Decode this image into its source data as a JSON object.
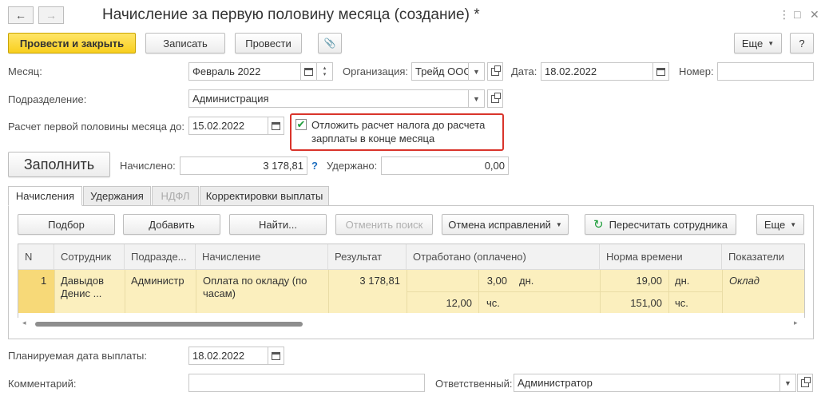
{
  "window": {
    "title": "Начисление за первую половину месяца (создание) *",
    "back_icon": "←",
    "forward_icon": "→",
    "menu_icon": "⋮",
    "maximize_icon": "□",
    "close_icon": "✕"
  },
  "toolbar": {
    "post_and_close": "Провести и закрыть",
    "save": "Записать",
    "post": "Провести",
    "attach_icon": "📎",
    "more": "Еще",
    "help": "?"
  },
  "form": {
    "month_label": "Месяц:",
    "month_value": "Февраль 2022",
    "org_label": "Организация:",
    "org_value": "Трейд ООС",
    "date_label": "Дата:",
    "date_value": "18.02.2022",
    "number_label": "Номер:",
    "number_value": "",
    "dept_label": "Подразделение:",
    "dept_value": "Администрация",
    "first_half_label": "Расчет первой половины месяца до:",
    "first_half_value": "15.02.2022",
    "defer_tax_checked": true,
    "defer_tax_label_line1": "Отложить расчет налога до расчета",
    "defer_tax_label_line2": "зарплаты в конце месяца",
    "fill_button": "Заполнить",
    "accrued_label": "Начислено:",
    "accrued_value": "3 178,81",
    "hint": "?",
    "withheld_label": "Удержано:",
    "withheld_value": "0,00"
  },
  "tabs": [
    {
      "label": "Начисления",
      "active": true,
      "disabled": false
    },
    {
      "label": "Удержания",
      "active": false,
      "disabled": false
    },
    {
      "label": "НДФЛ",
      "active": false,
      "disabled": true
    },
    {
      "label": "Корректировки выплаты",
      "active": false,
      "disabled": false
    }
  ],
  "tab_toolbar": {
    "pick": "Подбор",
    "add": "Добавить",
    "find": "Найти...",
    "cancel_search": "Отменить поиск",
    "cancel_corrections": "Отмена исправлений",
    "recalc": "Пересчитать сотрудника",
    "more": "Еще"
  },
  "table": {
    "columns": [
      "N",
      "Сотрудник",
      "Подразде...",
      "Начисление",
      "Результат",
      "Отработано (оплачено)",
      "Норма времени",
      "Показатели"
    ],
    "rows": [
      {
        "n": "1",
        "employee_line1": "Давыдов",
        "employee_line2": "Денис ...",
        "dept": "Администр",
        "accrual_line1": "Оплата по окладу (по",
        "accrual_line2": "часам)",
        "result": "3 178,81",
        "worked_days": "3,00",
        "worked_days_unit": "дн.",
        "worked_hours": "12,00",
        "worked_hours_unit": "чс.",
        "norm_days": "19,00",
        "norm_days_unit": "дн.",
        "norm_hours": "151,00",
        "norm_hours_unit": "чс.",
        "indicator": "Оклад"
      }
    ]
  },
  "footer": {
    "pay_date_label": "Планируемая дата выплаты:",
    "pay_date_value": "18.02.2022",
    "comment_label": "Комментарий:",
    "comment_value": "",
    "responsible_label": "Ответственный:",
    "responsible_value": "Администратор"
  }
}
